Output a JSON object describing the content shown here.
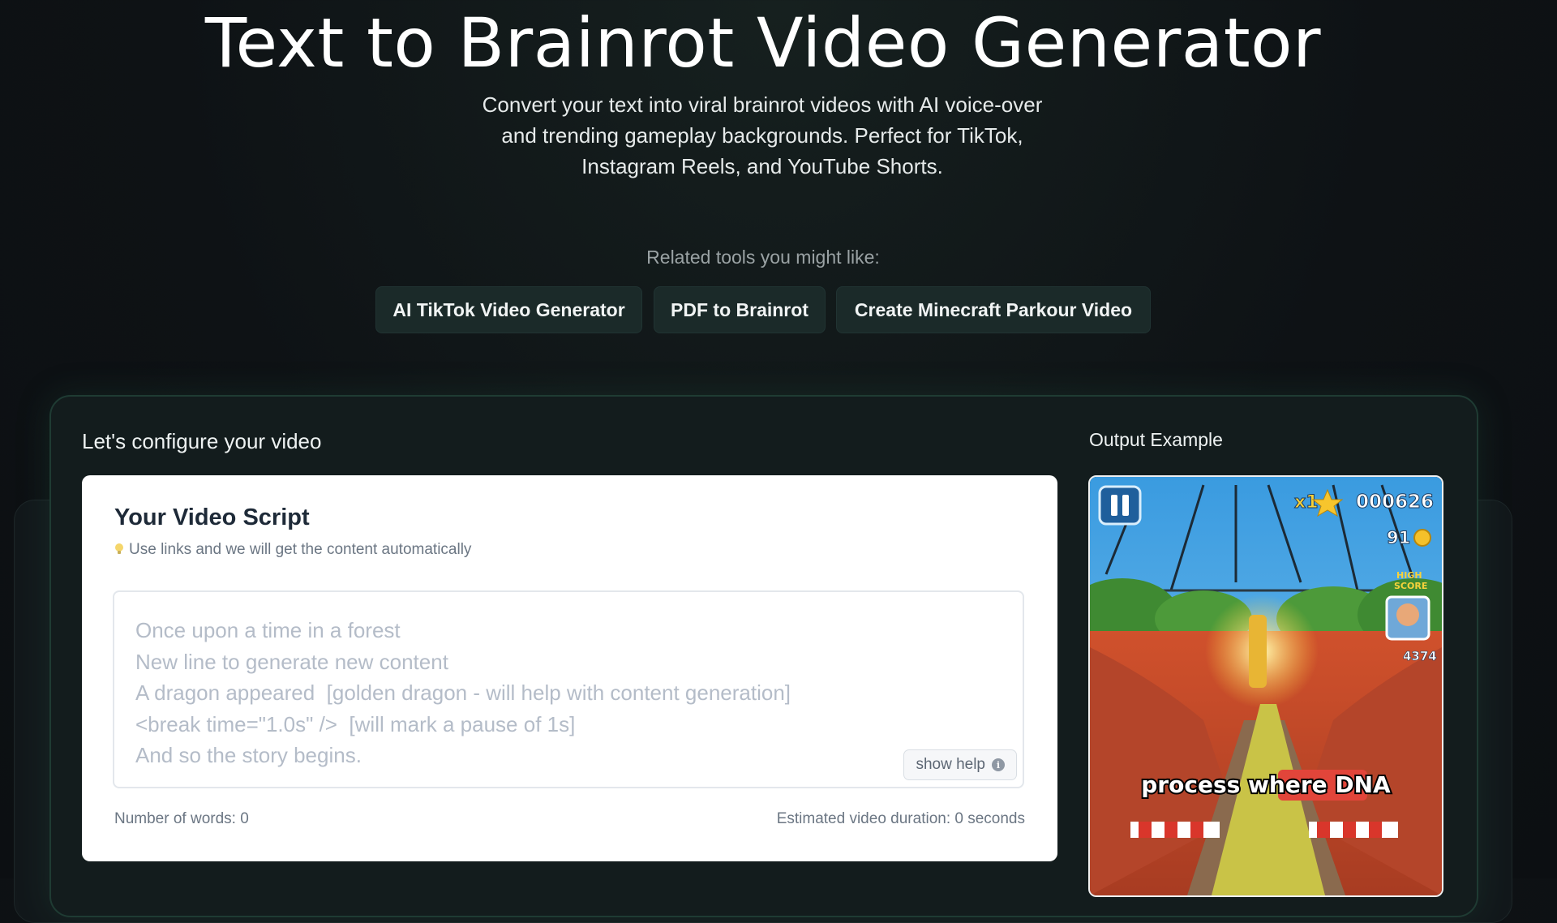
{
  "hero": {
    "title": "Text to Brainrot Video Generator",
    "subtitle": "Convert your text into viral brainrot videos with AI voice-over and trending gameplay backgrounds. Perfect for TikTok, Instagram Reels, and YouTube Shorts."
  },
  "related": {
    "label": "Related tools you might like:",
    "tools": [
      {
        "label": "AI TikTok Video Generator"
      },
      {
        "label": "PDF to Brainrot"
      },
      {
        "label": "Create Minecraft Parkour Video"
      }
    ]
  },
  "config": {
    "heading": "Let's configure your video"
  },
  "script": {
    "title": "Your Video Script",
    "hint": "Use links and we will get the content automatically",
    "placeholder_lines": [
      "Once upon a time in a forest",
      "New line to generate new content",
      "A dragon appeared  [golden dragon - will help with content generation]",
      "<break time=\"1.0s\" />  [will mark a pause of 1s]",
      "And so the story begins."
    ],
    "help_label": "show help",
    "word_count": "Number of words: 0",
    "duration": "Estimated video duration: 0 seconds"
  },
  "output": {
    "heading": "Output Example",
    "hud": {
      "multiplier": "x1",
      "score": "000626",
      "coins": "91",
      "high_score_label_1": "HIGH",
      "high_score_label_2": "SCORE",
      "high_score": "4374"
    },
    "caption": "process where DNA"
  },
  "colors": {
    "background": "#0e1215",
    "chip_bg": "#1b2a29",
    "card_border": "#1f3b33",
    "caption_highlight": "#e2453a"
  }
}
